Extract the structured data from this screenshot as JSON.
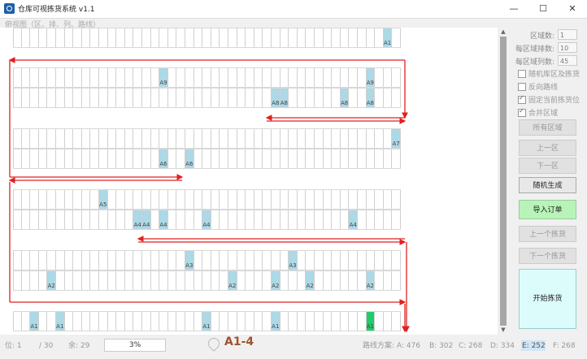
{
  "window": {
    "title": "仓库可视拣货系统 v1.1",
    "min_icon": "—",
    "max_icon": "☐",
    "close_icon": "✕"
  },
  "workspace": {
    "label": "俯视图（区、排、列、路线）"
  },
  "grid": {
    "cols": 45,
    "cell_labels": {
      "a1": "A1",
      "a2": "A2",
      "a3": "A3",
      "a4": "A4",
      "a5": "A5",
      "a6": "A6",
      "a7": "A7",
      "a8": "A8",
      "a9": "A9"
    }
  },
  "settings": {
    "zones_label": "区域数:",
    "zones_value": "1",
    "rows_label": "每区域排数:",
    "rows_value": "10",
    "cols_label": "每区域列数:",
    "cols_value": "45"
  },
  "options": [
    {
      "label": "随机库区及拣货",
      "checked": false
    },
    {
      "label": "反向路线",
      "checked": false
    },
    {
      "label": "固定当前拣货位",
      "checked": true
    },
    {
      "label": "合并区域",
      "checked": true
    }
  ],
  "buttons": {
    "all_zones": "所有区域",
    "prev_zone": "上一区",
    "next_zone": "下一区",
    "random_gen": "随机生成",
    "import_order": "导入订单",
    "prev_pick": "上一个拣货",
    "next_pick": "下一个拣货",
    "start_pick": "开始拣货"
  },
  "status": {
    "position": "位: 1",
    "total": "/ 30",
    "remaining": "余: 29",
    "progress_text": "3%",
    "progress": 0.03,
    "current_location": "A1-4",
    "route_label": "路线方案:",
    "routes": [
      "A: 476",
      "B: 302",
      "C: 268",
      "D: 334",
      "E: 252",
      "F: 268"
    ]
  },
  "colors": {
    "highlight": "#add8e6",
    "current": "#22cc66",
    "route": "#e02020",
    "location_text": "#a0522d"
  },
  "icons": {
    "location": "location-pin-icon",
    "scroll_up": "▲",
    "scroll_down": "▼"
  }
}
